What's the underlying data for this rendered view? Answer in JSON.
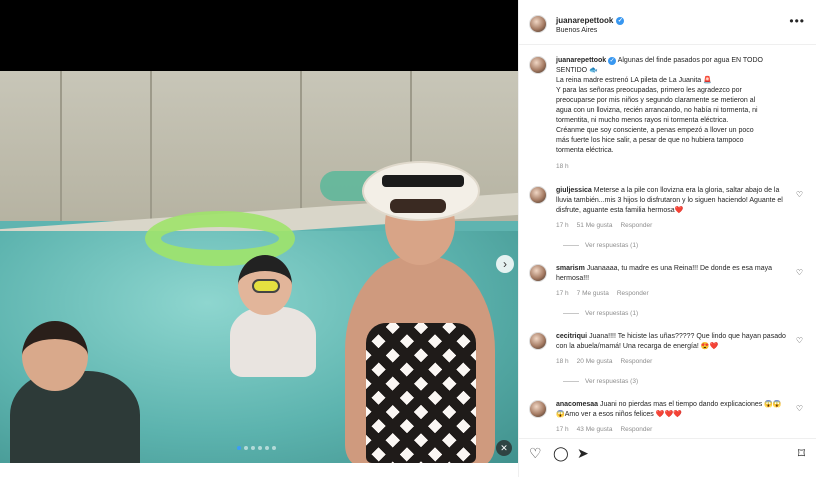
{
  "post": {
    "username": "juanarepettook",
    "location": "Buenos Aires",
    "more_icon": "more-horizontal-icon",
    "caption_lines": [
      "Algunas del finde pasados por agua EN TODO",
      "SENTIDO 🐟",
      "La reina madre estrenó LA pileta de La Juanita 🚨",
      "Y para las señoras preocupadas, primero les agradezco por",
      "preocuparse por mis niños y segundo claramente se metieron al",
      "agua con un llovizna, recién arrancando, no había ni tormenta, ni",
      "tormentita, ni mucho menos rayos ni tormenta eléctrica.",
      "Créanme que soy consciente, a penas empezó a llover un poco",
      "más fuerte los hice salir, a pesar de que no hubiera tampoco",
      "tormenta eléctrica."
    ],
    "caption_time": "18 h"
  },
  "carousel": {
    "next_icon": "chevron-right-icon",
    "mute_icon": "speaker-muted-icon"
  },
  "comments": [
    {
      "username": "giuljessica",
      "text": "Meterse a la pile con llovizna era la gloria, saltar abajo de la lluvia también...mis 3 hijos lo disfrutaron y lo siguen haciendo! Aguante el disfrute, aguante esta familia hermosa❤️",
      "time": "17 h",
      "likes": "51 Me gusta",
      "reply": "Responder",
      "replies": "Ver respuestas (1)"
    },
    {
      "username": "smarism",
      "text": "Juanaaaa, tu madre es una Reina!!! De donde es esa maya hermosa!!!",
      "time": "17 h",
      "likes": "7 Me gusta",
      "reply": "Responder",
      "replies": "Ver respuestas (1)"
    },
    {
      "username": "cecitriqui",
      "text": "Juana!!!! Te hiciste las uñas????? Que lindo que hayan pasado con la abuela/mamá! Una recarga de energía! 😍❤️",
      "time": "18 h",
      "likes": "20 Me gusta",
      "reply": "Responder",
      "replies": "Ver respuestas (3)"
    },
    {
      "username": "anacomesaa",
      "text": "Juani no pierdas mas el tiempo dando explicaciones 😱😱😱Amo ver a esos niños felices ❤️❤️❤️",
      "time": "17 h",
      "likes": "43 Me gusta",
      "reply": "Responder",
      "replies": ""
    }
  ],
  "actions": {
    "like_icon": "heart-icon",
    "comment_icon": "comment-icon",
    "share_icon": "send-icon",
    "save_icon": "bookmark-icon"
  }
}
